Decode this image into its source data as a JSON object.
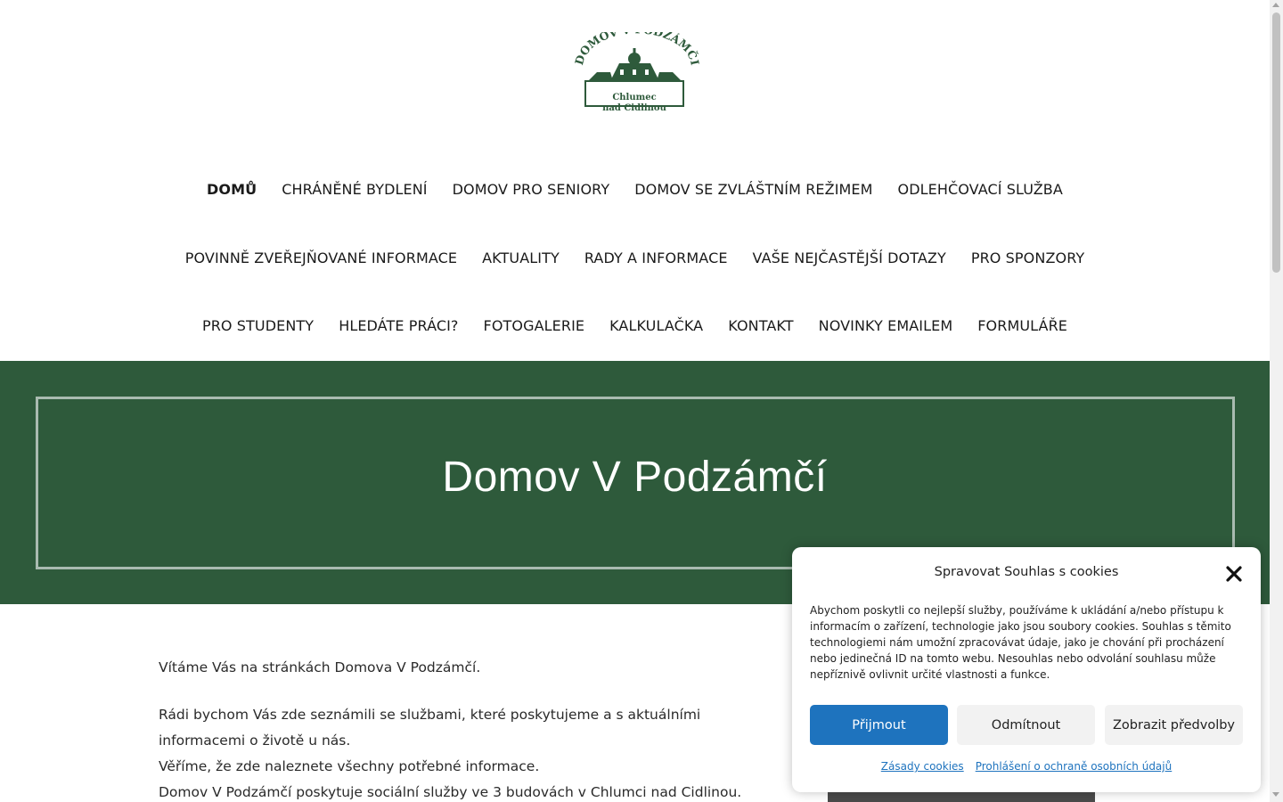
{
  "header": {
    "logo": {
      "arc_text": "DOMOV V PODZÁMČÍ",
      "line1": "Chlumec",
      "line2": "nad Cidlinou",
      "color": "#2e5a3b"
    }
  },
  "nav": {
    "row1": [
      "DOMŮ",
      "CHRÁNĚNÉ BYDLENÍ",
      "DOMOV PRO SENIORY",
      "DOMOV SE ZVLÁŠTNÍM REŽIMEM",
      "ODLEHČOVACÍ SLUŽBA"
    ],
    "row2": [
      "POVINNĚ ZVEŘEJŇOVANÉ INFORMACE",
      "AKTUALITY",
      "RADY A INFORMACE",
      "VAŠE NEJČASTĚJŠÍ DOTAZY",
      "PRO SPONZORY"
    ],
    "row3": [
      "PRO STUDENTY",
      "HLEDÁTE PRÁCI?",
      "FOTOGALERIE",
      "KALKULAČKA",
      "KONTAKT",
      "NOVINKY EMAILEM",
      "FORMULÁŘE"
    ]
  },
  "hero": {
    "title": "Domov V Podzámčí",
    "background": "#2e5a3b"
  },
  "content": {
    "welcome": "Vítáme Vás na stránkách Domova V Podzámčí.",
    "intro": "Rádi bychom Vás zde seznámili se službami, které poskytujeme a s aktuálními informacemi o životě u nás.",
    "believe": "Věříme, že zde naleznete všechny potřebné informace.",
    "services": "Domov V Podzámčí poskytuje sociální služby ve 3 budovách v Chlumci nad Cidlinou."
  },
  "cookie": {
    "title": "Spravovat Souhlas s cookies",
    "text": "Abychom poskytli co nejlepší služby, používáme k ukládání a/nebo přístupu k informacím o zařízení, technologie jako jsou soubory cookies. Souhlas s těmito technologiemi nám umožní zpracovávat údaje, jako je chování při procházení nebo jedinečná ID na tomto webu. Nesouhlas nebo odvolání souhlasu může nepříznivě ovlivnit určité vlastnosti a funkce.",
    "accept": "Přijmout",
    "deny": "Odmítnout",
    "preferences": "Zobrazit předvolby",
    "link_policy": "Zásady cookies",
    "link_privacy": "Prohlášení o ochraně osobních údajů",
    "accent": "#1e73be"
  }
}
